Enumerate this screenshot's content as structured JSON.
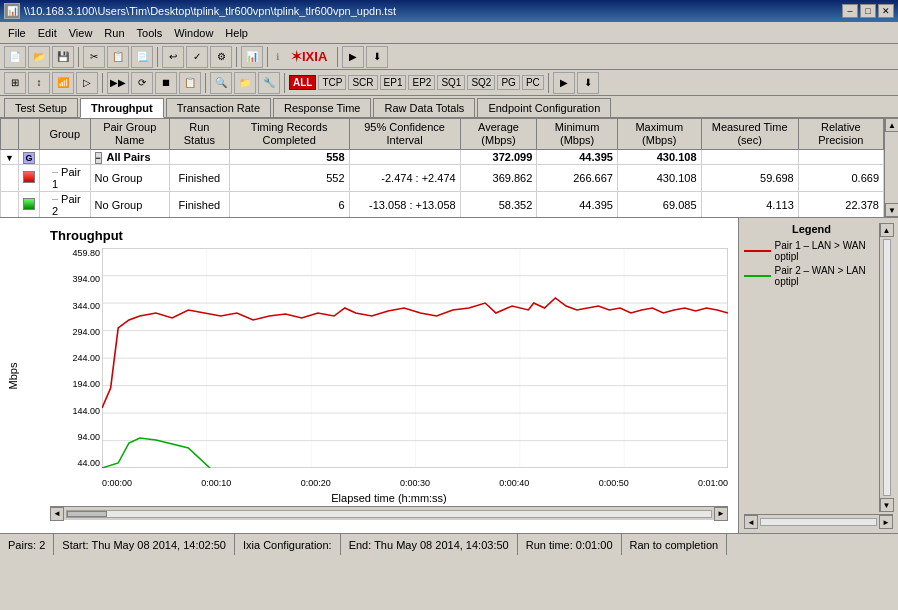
{
  "titleBar": {
    "title": "\\\\10.168.3.100\\Users\\Tim\\Desktop\\tplink_tlr600vpn\\tplink_tlr600vpn_updn.tst",
    "icon": "📊",
    "minimize": "–",
    "restore": "□",
    "close": "✕"
  },
  "menuBar": {
    "items": [
      "File",
      "Edit",
      "View",
      "Run",
      "Tools",
      "Window",
      "Help"
    ]
  },
  "toolbar1": {
    "buttons": [
      "📄",
      "📂",
      "💾",
      "✂",
      "📋",
      "📃",
      "↩",
      "✓",
      "🔧",
      "📊"
    ],
    "ixia": "IXIA"
  },
  "toolbar2": {
    "all": "ALL",
    "protocols": [
      "TCP",
      "SCR",
      "EP1",
      "EP2",
      "SQ1",
      "SQ2",
      "PG",
      "PC"
    ]
  },
  "tabs": {
    "items": [
      "Test Setup",
      "Throughput",
      "Transaction Rate",
      "Response Time",
      "Raw Data Totals",
      "Endpoint Configuration"
    ],
    "active": "Throughput"
  },
  "table": {
    "headers": {
      "group": "Group",
      "pairGroupName": "Pair Group Name",
      "runStatus": "Run Status",
      "timingRecords": "Timing Records Completed",
      "confidence": "95% Confidence Interval",
      "average": "Average (Mbps)",
      "minimum": "Minimum (Mbps)",
      "maximum": "Maximum (Mbps)",
      "measuredTime": "Measured Time (sec)",
      "relativePrecision": "Relative Precision"
    },
    "rows": [
      {
        "type": "group",
        "group": "",
        "pairGroupName": "All Pairs",
        "runStatus": "",
        "timingRecords": "558",
        "confidence": "",
        "average": "372.099",
        "minimum": "44.395",
        "maximum": "430.108",
        "measuredTime": "",
        "relativePrecision": ""
      },
      {
        "type": "pair",
        "pairNum": "1",
        "group": "No Group",
        "runStatus": "Finished",
        "timingRecords": "552",
        "confidence": "-2.474 : +2.474",
        "average": "369.862",
        "minimum": "266.667",
        "maximum": "430.108",
        "measuredTime": "59.698",
        "relativePrecision": "0.669"
      },
      {
        "type": "pair",
        "pairNum": "2",
        "group": "No Group",
        "runStatus": "Finished",
        "timingRecords": "6",
        "confidence": "-13.058 : +13.058",
        "average": "58.352",
        "minimum": "44.395",
        "maximum": "69.085",
        "measuredTime": "4.113",
        "relativePrecision": "22.378"
      }
    ]
  },
  "chart": {
    "title": "Throughput",
    "yAxisLabel": "Mbps",
    "xAxisLabel": "Elapsed time (h:mm:ss)",
    "yTicks": [
      "44.00",
      "94.00",
      "144.00",
      "194.00",
      "244.00",
      "294.00",
      "344.00",
      "394.00",
      "459.80"
    ],
    "xTicks": [
      "0:00:00",
      "0:00:10",
      "0:00:20",
      "0:00:30",
      "0:00:40",
      "0:00:50",
      "0:01:00"
    ],
    "legend": {
      "title": "Legend",
      "items": [
        {
          "label": "Pair 1 – LAN > WAN optipl",
          "color": "#cc0000"
        },
        {
          "label": "Pair 2 – WAN > LAN optipl",
          "color": "#00aa00"
        }
      ]
    }
  },
  "statusBar": {
    "pairs": "Pairs: 2",
    "start": "Start: Thu May 08 2014, 14:02:50",
    "ixiaConfig": "Ixia Configuration:",
    "end": "End: Thu May 08 2014, 14:03:50",
    "runtime": "Run time: 0:01:00",
    "status": "Ran to completion"
  }
}
